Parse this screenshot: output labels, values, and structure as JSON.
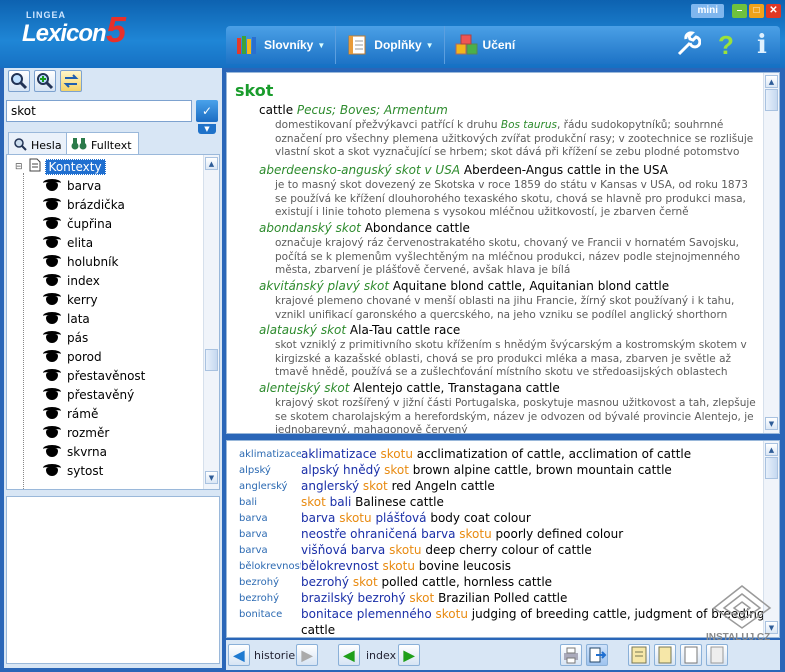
{
  "app": {
    "brand_small": "LINGEA",
    "brand_word": "Lexicon",
    "brand_num": "5",
    "mini_label": "mini",
    "win_min": "–",
    "win_max": "□",
    "win_close": "✕"
  },
  "menu": {
    "slovniky": "Slovníky",
    "doplnky": "Doplňky",
    "uceni": "Učení",
    "help_glyph": "?",
    "info_glyph": "i"
  },
  "search": {
    "value": "skot",
    "ok_glyph": "✓"
  },
  "left_tabs": {
    "hesla": "Hesla",
    "fulltext": "Fulltext"
  },
  "tree": {
    "root": "Kontexty",
    "items": [
      "barva",
      "brázdička",
      "čupřina",
      "elita",
      "holubník",
      "index",
      "kerry",
      "lata",
      "pás",
      "porod",
      "přestavěnost",
      "přestavěný",
      "rámě",
      "rozměr",
      "skvrna",
      "sytost"
    ]
  },
  "entry": {
    "headword": "skot",
    "senses": [
      {
        "cz": "",
        "en": "cattle",
        "lat": "Pecus; Boves; Armentum",
        "def": [
          "domestikovaní přežvýkavci patřící k druhu ",
          "Bos taurus",
          ", řádu sudokopytníků; souhrnné označení pro všechny plemena užitkových zvířat produkční rasy; v zootechnice se rozlišuje vlastní skot a skot vyznačující se hrbem; skot dává při křížení se zebu plodné potomstvo"
        ]
      },
      {
        "cz": "aberdeensko-anguský skot v USA",
        "en": "Aberdeen-Angus cattle in the USA",
        "def": [
          "je to masný skot dovezený ze Skotska v roce 1859 do státu v Kansas v USA, od roku 1873 se používá ke křížení dlouhorohého texaského skotu, chová se hlavně pro produkci masa, existují i linie tohoto plemena s vysokou mléčnou užitkovostí, je zbarven černě"
        ]
      },
      {
        "cz": "abondanský skot",
        "en": "Abondance cattle",
        "def": [
          "označuje krajový ráz červenostrakatého skotu, chovaný ve Francii v hornatém Savojsku, počítá se k plemenům vyšlechtěným na mléčnou produkci, název podle stejnojmenného města, zbarvení je plášťově červené, avšak hlava je bílá"
        ]
      },
      {
        "cz": "akvitánský plavý skot",
        "en": "Aquitane blond cattle, Aquitanian blond cattle",
        "def": [
          "krajové plemeno chované v menší oblasti na jihu Francie, žírný skot používaný i k tahu, vznikl unifikací garonského a quercského, na jeho vzniku se podílel anglický shorthorn"
        ]
      },
      {
        "cz": "alatauský skot",
        "en": "Ala-Tau cattle race",
        "def": [
          "skot vzniklý z primitivního skotu křížením s hnědým švýcarským a kostromským skotem v kirgizské a kazašské oblasti, chová se pro produkci mléka a masa, zbarven je světle až tmavě hnědě, používá se a zušlechťování místního skotu ve středoasijských oblastech"
        ]
      },
      {
        "cz": "alentejský skot",
        "en": "Alentejo cattle, Transtagana cattle",
        "def": [
          "krajový skot rozšířený v jižní části Portugalska, poskytuje masnou užitkovost a tah, zlepšuje se skotem charolajským a herefordským, název je odvozen od bývalé provincie Alentejo, je jednobarevný, mahagonově červený"
        ]
      }
    ]
  },
  "fulltext_rows": [
    {
      "key": "aklimatizace",
      "parts": [
        [
          "b",
          "aklimatizace "
        ],
        [
          "o",
          "skotu"
        ]
      ],
      "en": "acclimatization of cattle, acclimation of cattle"
    },
    {
      "key": "alpský",
      "parts": [
        [
          "b",
          "alpský hnědý "
        ],
        [
          "o",
          "skot"
        ]
      ],
      "en": "brown alpine cattle, brown mountain cattle"
    },
    {
      "key": "anglerský",
      "parts": [
        [
          "b",
          "anglerský "
        ],
        [
          "o",
          "skot"
        ]
      ],
      "en": "red Angeln cattle"
    },
    {
      "key": "bali",
      "parts": [
        [
          "o",
          "skot "
        ],
        [
          "b",
          "bali"
        ]
      ],
      "en": "Balinese cattle"
    },
    {
      "key": "barva",
      "parts": [
        [
          "b",
          "barva "
        ],
        [
          "o",
          "skotu "
        ],
        [
          "b",
          "plášťová"
        ]
      ],
      "en": "body coat colour"
    },
    {
      "key": "barva",
      "parts": [
        [
          "b",
          "neostře ohraničená barva "
        ],
        [
          "o",
          "skotu"
        ]
      ],
      "en": "poorly defined colour"
    },
    {
      "key": "barva",
      "parts": [
        [
          "b",
          "višňová barva "
        ],
        [
          "o",
          "skotu"
        ]
      ],
      "en": "deep cherry colour of cattle"
    },
    {
      "key": "bělokrevnost",
      "parts": [
        [
          "b",
          "bělokrevnost "
        ],
        [
          "o",
          "skotu"
        ]
      ],
      "en": "bovine leucosis"
    },
    {
      "key": "bezrohý",
      "parts": [
        [
          "b",
          "bezrohý "
        ],
        [
          "o",
          "skot"
        ]
      ],
      "en": "polled cattle, hornless cattle"
    },
    {
      "key": "bezrohý",
      "parts": [
        [
          "b",
          "brazilský bezrohý "
        ],
        [
          "o",
          "skot"
        ]
      ],
      "en": "Brazilian Polled cattle"
    },
    {
      "key": "bonitace",
      "parts": [
        [
          "b",
          "bonitace plemenného "
        ],
        [
          "o",
          "skotu"
        ]
      ],
      "en": "judging of breeding cattle, judgment of breeding"
    },
    {
      "key": "",
      "parts": [],
      "en": "cattle"
    }
  ],
  "status": {
    "historie": "historie",
    "index": "index"
  },
  "watermark": "INSTALUJ.CZ",
  "colors": {
    "accent": "#1f86d6",
    "headword": "#1a9c2c",
    "czech_term": "#1a2fa8",
    "highlight": "#e88a10"
  }
}
